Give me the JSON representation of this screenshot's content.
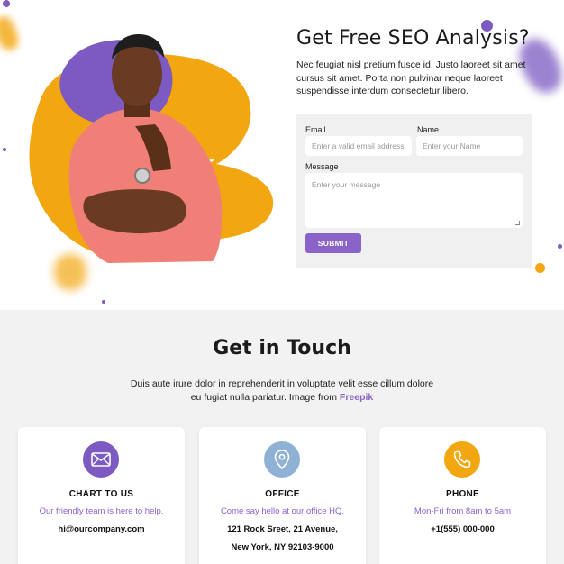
{
  "colors": {
    "accent": "#8a63c8",
    "orange": "#f2a60f",
    "light_blue": "#8fb2d4",
    "form_bg": "#f0f0f0",
    "section_bg": "#f2f2f2"
  },
  "hero": {
    "title": "Get Free SEO Analysis?",
    "description": "Nec feugiat nisl pretium fusce id. Justo laoreet sit amet cursus sit amet. Porta non pulvinar neque laoreet suspendisse interdum consectetur libero."
  },
  "form": {
    "email_label": "Email",
    "email_placeholder": "Enter a valid email address",
    "name_label": "Name",
    "name_placeholder": "Enter your Name",
    "message_label": "Message",
    "message_placeholder": "Enter your message",
    "submit_label": "SUBMIT"
  },
  "contact": {
    "title": "Get in Touch",
    "description": "Duis aute irure dolor in reprehenderit in voluptate velit esse cillum dolore eu fugiat nulla pariatur. Image from",
    "link_text": "Freepik",
    "cards": [
      {
        "icon": "envelope-icon",
        "title": "CHART TO US",
        "subtitle": "Our friendly team is here to help.",
        "line1": "hi@ourcompany.com",
        "line2": ""
      },
      {
        "icon": "location-pin-icon",
        "title": "OFFICE",
        "subtitle": "Come say hello at our office HQ.",
        "line1": "121 Rock Sreet, 21 Avenue,",
        "line2": "New York, NY 92103-9000"
      },
      {
        "icon": "phone-icon",
        "title": "PHONE",
        "subtitle": "Mon-Fri from 8am to 5am",
        "line1": "+1(555) 000-000",
        "line2": ""
      }
    ]
  }
}
